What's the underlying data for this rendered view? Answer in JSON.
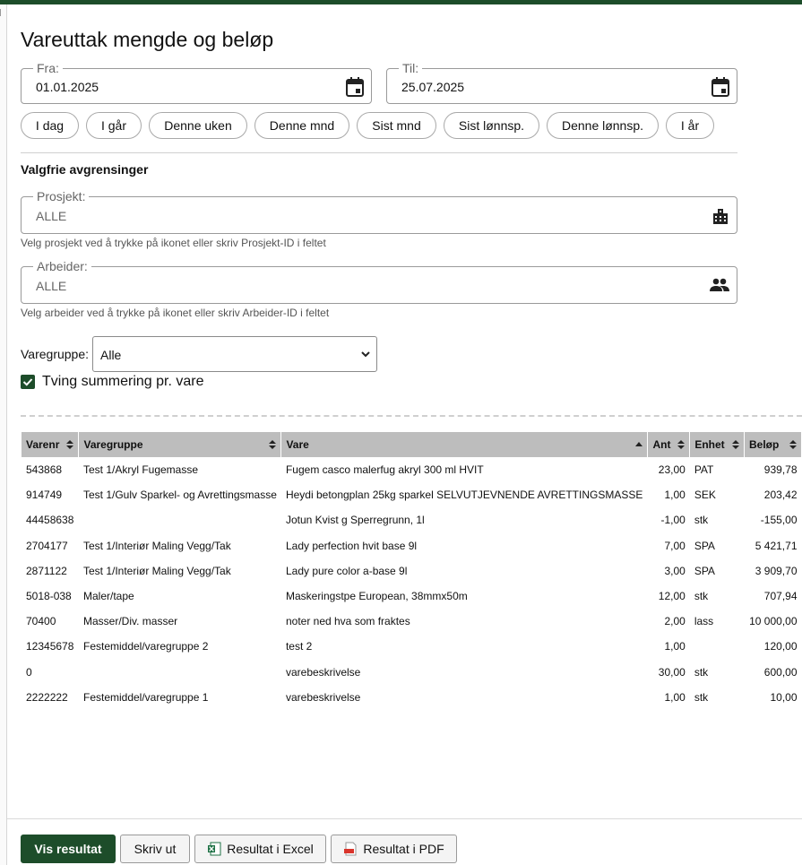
{
  "page": {
    "title": "Vareuttak mengde og beløp"
  },
  "date_from": {
    "label": "Fra:",
    "value": "01.01.2025",
    "icon": "calendar-icon"
  },
  "date_to": {
    "label": "Til:",
    "value": "25.07.2025",
    "icon": "calendar-icon"
  },
  "quick_ranges": [
    "I dag",
    "I går",
    "Denne uken",
    "Denne mnd",
    "Sist mnd",
    "Sist lønnsp.",
    "Denne lønnsp.",
    "I år"
  ],
  "filters": {
    "title": "Valgfrie avgrensinger",
    "project": {
      "label": "Prosjekt:",
      "value": "ALLE",
      "hint": "Velg prosjekt ved å trykke på ikonet eller skriv Prosjekt-ID i feltet",
      "icon": "building-icon"
    },
    "worker": {
      "label": "Arbeider:",
      "value": "ALLE",
      "hint": "Velg arbeider ved å trykke på ikonet eller skriv Arbeider-ID i feltet",
      "icon": "people-icon"
    },
    "product_group": {
      "label": "Varegruppe:",
      "selected": "Alle"
    },
    "force_sum": {
      "label": "Tving summering pr. vare",
      "checked": true
    }
  },
  "table": {
    "columns": [
      "Varenr",
      "Varegruppe",
      "Vare",
      "Ant",
      "Enhet",
      "Beløp"
    ],
    "rows": [
      [
        "543868",
        "Test 1/Akryl Fugemasse",
        "Fugem casco malerfug akryl 300 ml HVIT",
        "23,00",
        "PAT",
        "939,78"
      ],
      [
        "914749",
        "Test 1/Gulv Sparkel- og Avrettingsmasse",
        "Heydi betongplan 25kg sparkel SELVUTJEVNENDE AVRETTINGSMASSE",
        "1,00",
        "SEK",
        "203,42"
      ],
      [
        "44458638",
        "",
        "Jotun Kvist g Sperregrunn, 1l",
        "-1,00",
        "stk",
        "-155,00"
      ],
      [
        "2704177",
        "Test 1/Interiør Maling Vegg/Tak",
        "Lady perfection hvit base 9l",
        "7,00",
        "SPA",
        "5 421,71"
      ],
      [
        "2871122",
        "Test 1/Interiør Maling Vegg/Tak",
        "Lady pure color a-base 9l",
        "3,00",
        "SPA",
        "3 909,70"
      ],
      [
        "5018-038",
        "Maler/tape",
        "Maskeringstpe European, 38mmx50m",
        "12,00",
        "stk",
        "707,94"
      ],
      [
        "70400",
        "Masser/Div. masser",
        "noter ned hva som fraktes",
        "2,00",
        "lass",
        "10 000,00"
      ],
      [
        "12345678",
        "Festemiddel/varegruppe 2",
        "test 2",
        "1,00",
        "",
        "120,00"
      ],
      [
        "0",
        "",
        "varebeskrivelse",
        "30,00",
        "stk",
        "600,00"
      ],
      [
        "2222222",
        "Festemiddel/varegruppe 1",
        "varebeskrivelse",
        "1,00",
        "stk",
        "10,00"
      ]
    ]
  },
  "actions": {
    "show": "Vis resultat",
    "print": "Skriv ut",
    "excel": "Resultat i Excel",
    "pdf": "Resultat i PDF"
  },
  "colors": {
    "accent": "#1d4d2a",
    "header_bg": "#bdbdbd"
  }
}
